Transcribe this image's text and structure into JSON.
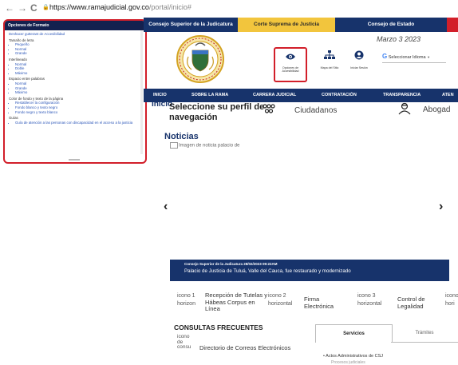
{
  "browser": {
    "back": "←",
    "forward": "→",
    "reload": "C",
    "lock": "🔒",
    "url_domain": "https://www.ramajudicial.gov.co",
    "url_path": "/portal/inicio#"
  },
  "access_panel": {
    "title": "Opciones de Formato",
    "reset": "Deshacer gutterant de Accesibilidad",
    "font_section": "Tamaño de letra",
    "font_items": [
      "Pequeño",
      "Normal",
      "Grande"
    ],
    "spacing_section": "Interlineado",
    "spacing_items": [
      "Normal",
      "Doble",
      "Máximo"
    ],
    "word_section": "Espacio entre palabras",
    "word_items": [
      "Normal",
      "Grande",
      "Máximo"
    ],
    "color_section": "Color de fondo y texto de la página",
    "color_items": [
      "Restablecer la configuración",
      "Fondo blanco y texto negro",
      "Fondo negro y texto blanco"
    ],
    "guide_section": "Guías",
    "guide_items": [
      "Guía de atención a las personas con discapacidad en el acceso a la justicia"
    ]
  },
  "toplinks": {
    "link1": "Consejo Superior de la Judicatura",
    "link2": "Corte Suprema de Justicia",
    "link3": "Consejo de Estado"
  },
  "header": {
    "date": "Marzo 3 2023",
    "tool_access": "Opciones de Accesibilidad",
    "tool_sitemap": "Mapa del Sitio",
    "tool_login": "Iniciar Sesión",
    "lang_label": "Seleccionar Idioma",
    "lang_caret": "▼"
  },
  "menu": {
    "items": [
      "INICIO",
      "SOBRE LA RAMA",
      "CARRERA JUDICIAL",
      "CONTRATACIÓN",
      "TRANSPARENCIA",
      "ATEN"
    ]
  },
  "content": {
    "inicio": "Inicio",
    "profile_title": "Seleccione su perfil de navegación",
    "profile_1": "Ciudadanos",
    "profile_2": "Abogad",
    "noticias": "Noticias",
    "news_img_alt": "Imagen de noticia palacio de",
    "prev": "‹",
    "next": "›"
  },
  "banner": {
    "meta": "Consejo Superior de la Judicatura   28/02/2023 09:22AM",
    "title": "Palacio de Justicia de Tuluá, Valle del Cauca, fue restaurado y modernizado"
  },
  "quicklinks": {
    "t1_icon": "icono 1 horizon",
    "t1_label": "Recepción de Tutelas y Hábeas Corpus en Línea",
    "t2_icon": "icono 2 horizontal",
    "t3_label": "Firma Electrónica",
    "t4_icon": "icono 3 horizontal",
    "t5_label": "Control de Legalidad",
    "t6_icon": "icono hori"
  },
  "consultas": {
    "title": "CONSULTAS FRECUENTES",
    "icon_alt": "icono de consu",
    "link": "Directorio de Correos Electrónicos",
    "tab_services": "Servicios",
    "tab_tramites": "Trámites",
    "service_item": "Actos Administrativos de CSJ",
    "service_item2": "Procesos judiciales"
  }
}
